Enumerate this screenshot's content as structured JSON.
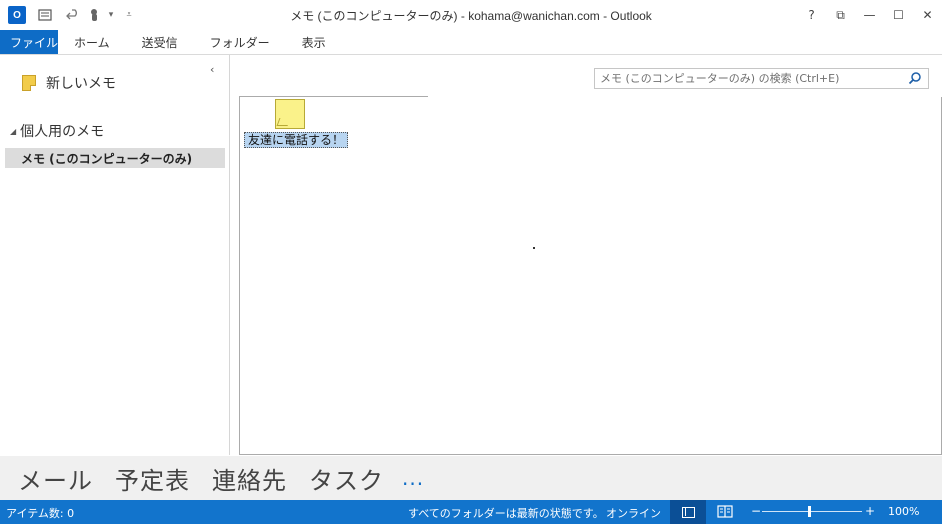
{
  "window": {
    "title": "メモ (このコンピューターのみ) - kohama@wanichan.com - Outlook",
    "app_icon": "O",
    "controls": [
      "?",
      "⧉",
      "—",
      "☐",
      "✕"
    ]
  },
  "ribbon": {
    "tabs": [
      "ファイル",
      "ホーム",
      "送受信",
      "フォルダー",
      "表示"
    ]
  },
  "sidebar": {
    "new_note_label": "新しいメモ",
    "group_label": "個人用のメモ",
    "selected_folder": "メモ (このコンピューターのみ)"
  },
  "search": {
    "placeholder": "メモ (このコンピューターのみ) の検索 (Ctrl+E)"
  },
  "notes": [
    {
      "caption": "友達に電話する！"
    }
  ],
  "navigation": {
    "items": [
      "メール",
      "予定表",
      "連絡先",
      "タスク"
    ],
    "more": "..."
  },
  "status": {
    "item_count": "アイテム数: 0",
    "sync_status": "すべてのフォルダーは最新の状態です。",
    "connection": "オンライン",
    "zoom_minus": "−",
    "zoom_plus": "+",
    "zoom": "100%",
    "zoom_level_pct": 100
  },
  "colors": {
    "accent": "#1274cc",
    "file_tab": "#0e6cc6",
    "note_yellow": "#faf28a",
    "selection": "#b8d5f1"
  },
  "icons": {
    "app": "outlook-icon",
    "new_note": "note-icon",
    "search": "search-icon"
  }
}
